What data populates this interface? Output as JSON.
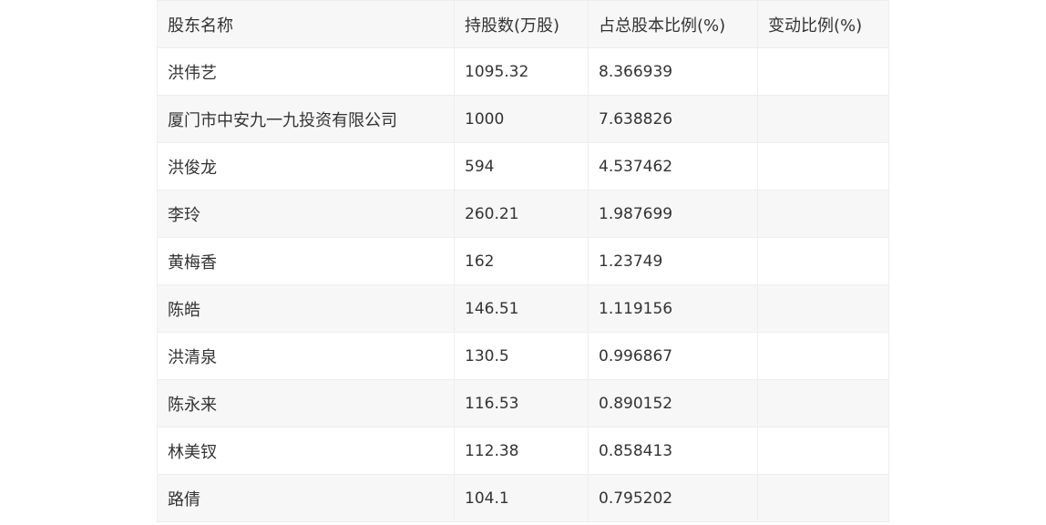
{
  "table": {
    "headers": [
      "股东名称",
      "持股数(万股)",
      "占总股本比例(%)",
      "变动比例(%)"
    ],
    "rows": [
      {
        "name": "洪伟艺",
        "shares": "1095.32",
        "ratio": "8.366939",
        "change": ""
      },
      {
        "name": "厦门市中安九一九投资有限公司",
        "shares": "1000",
        "ratio": "7.638826",
        "change": ""
      },
      {
        "name": "洪俊龙",
        "shares": "594",
        "ratio": "4.537462",
        "change": ""
      },
      {
        "name": "李玲",
        "shares": "260.21",
        "ratio": "1.987699",
        "change": ""
      },
      {
        "name": "黄梅香",
        "shares": "162",
        "ratio": "1.23749",
        "change": ""
      },
      {
        "name": "陈皓",
        "shares": "146.51",
        "ratio": "1.119156",
        "change": ""
      },
      {
        "name": "洪清泉",
        "shares": "130.5",
        "ratio": "0.996867",
        "change": ""
      },
      {
        "name": "陈永来",
        "shares": "116.53",
        "ratio": "0.890152",
        "change": ""
      },
      {
        "name": "林美钗",
        "shares": "112.38",
        "ratio": "0.858413",
        "change": ""
      },
      {
        "name": "路倩",
        "shares": "104.1",
        "ratio": "0.795202",
        "change": ""
      }
    ]
  }
}
